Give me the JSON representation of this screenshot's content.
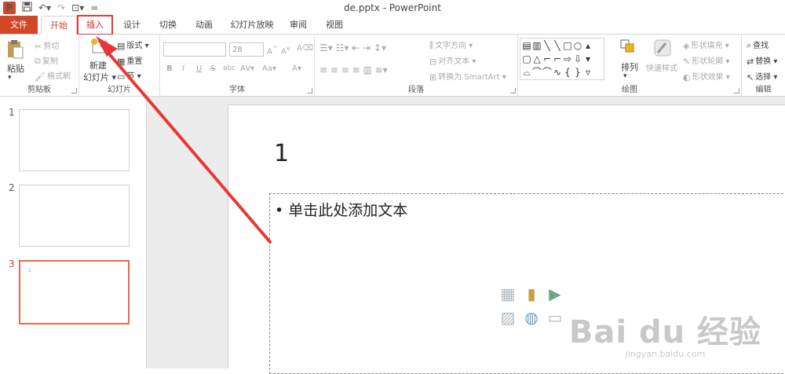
{
  "title": "de.pptx - PowerPoint",
  "quick_access": {
    "logo": "P",
    "save_icon": "save-icon",
    "undo_icon": "undo-icon",
    "redo_icon": "redo-icon",
    "start_icon": "start-from-beginning-icon",
    "more": "="
  },
  "tabs": [
    "文件",
    "开始",
    "插入",
    "设计",
    "切换",
    "动画",
    "幻灯片放映",
    "审阅",
    "视图"
  ],
  "ribbon": {
    "clipboard": {
      "label": "剪贴板",
      "paste": "粘贴",
      "cut": "剪切",
      "copy": "复制",
      "format_painter": "格式刷"
    },
    "slides": {
      "label": "幻灯片",
      "new_slide_1": "新建",
      "new_slide_2": "幻灯片",
      "layout": "版式",
      "reset": "重置",
      "section": "节"
    },
    "font": {
      "label": "字体",
      "font_name": "",
      "font_size": "28",
      "bold": "B",
      "italic": "I",
      "underline": "U",
      "strike": "S",
      "shadow": "abc",
      "spacing": "AV",
      "case": "Aa",
      "color": "A",
      "grow": "A",
      "shrink": "A",
      "clear": "A"
    },
    "paragraph": {
      "label": "段落",
      "text_direction": "文字方向",
      "align_text": "对齐文本",
      "convert_smartart": "转换为 SmartArt"
    },
    "drawing": {
      "label": "绘图",
      "arrange": "排列",
      "quick_styles": "快速样式",
      "shape_fill": "形状填充",
      "shape_outline": "形状轮廓",
      "shape_effects": "形状效果"
    },
    "editing": {
      "label": "编辑",
      "find": "查找",
      "replace": "替换",
      "select": "选择"
    }
  },
  "slides": [
    {
      "number": "1",
      "tiny": ""
    },
    {
      "number": "2",
      "tiny": ""
    },
    {
      "number": "3",
      "tiny": "1"
    }
  ],
  "current_slide": {
    "title": "1",
    "body": "• 单击此处添加文本"
  },
  "watermark": {
    "main": "Bai du 经验",
    "sub": "jingyan.baidu.com"
  },
  "colors": {
    "accent": "#d24726",
    "highlight": "#e53935"
  }
}
